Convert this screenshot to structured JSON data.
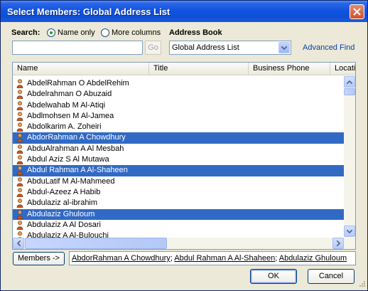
{
  "window": {
    "title": "Select Members: Global Address List"
  },
  "search": {
    "label": "Search:",
    "option_name_only": "Name only",
    "option_more_columns": "More columns",
    "selected_option": "Name only",
    "input_value": "",
    "go_label": "Go"
  },
  "address_book": {
    "label": "Address Book",
    "selected": "Global Address List",
    "advanced_find": "Advanced Find"
  },
  "columns": [
    "Name",
    "Title",
    "Business Phone",
    "Locatic"
  ],
  "rows": [
    {
      "name": "AbdelRahman O AbdelRehim",
      "selected": false
    },
    {
      "name": "Abdelrahman O Abuzaid",
      "selected": false
    },
    {
      "name": "Abdelwahab M Al-Atiqi",
      "selected": false
    },
    {
      "name": "Abdlmohsen M Al-Jamea",
      "selected": false
    },
    {
      "name": "Abdolkarim A. Zoheiri",
      "selected": false
    },
    {
      "name": "AbdorRahman A Chowdhury",
      "selected": true
    },
    {
      "name": "AbduAlrahman A Al Mesbah",
      "selected": false
    },
    {
      "name": "Abdul Aziz S Al Mutawa",
      "selected": false
    },
    {
      "name": "Abdul Rahman A Al-Shaheen",
      "selected": true
    },
    {
      "name": "AbduLatif M Al-Mahmeed",
      "selected": false
    },
    {
      "name": "Abdul-Azeez A Habib",
      "selected": false
    },
    {
      "name": "Abdulaziz  al-ibrahim",
      "selected": false
    },
    {
      "name": "Abdulaziz  Ghuloum",
      "selected": true
    },
    {
      "name": "Abdulaziz A Al Dosari",
      "selected": false
    },
    {
      "name": "Abdulaziz A Al-Bulouchi",
      "selected": false
    }
  ],
  "members": {
    "button_label": "Members ->",
    "list": [
      "AbdorRahman A Chowdhury",
      "Abdul Rahman A Al-Shaheen",
      "Abdulaziz  Ghuloum"
    ],
    "sep": "; "
  },
  "buttons": {
    "ok": "OK",
    "cancel": "Cancel"
  },
  "colors": {
    "titlebar": "#0f4fd6",
    "selection": "#316ac5",
    "link": "#0b40a4"
  }
}
